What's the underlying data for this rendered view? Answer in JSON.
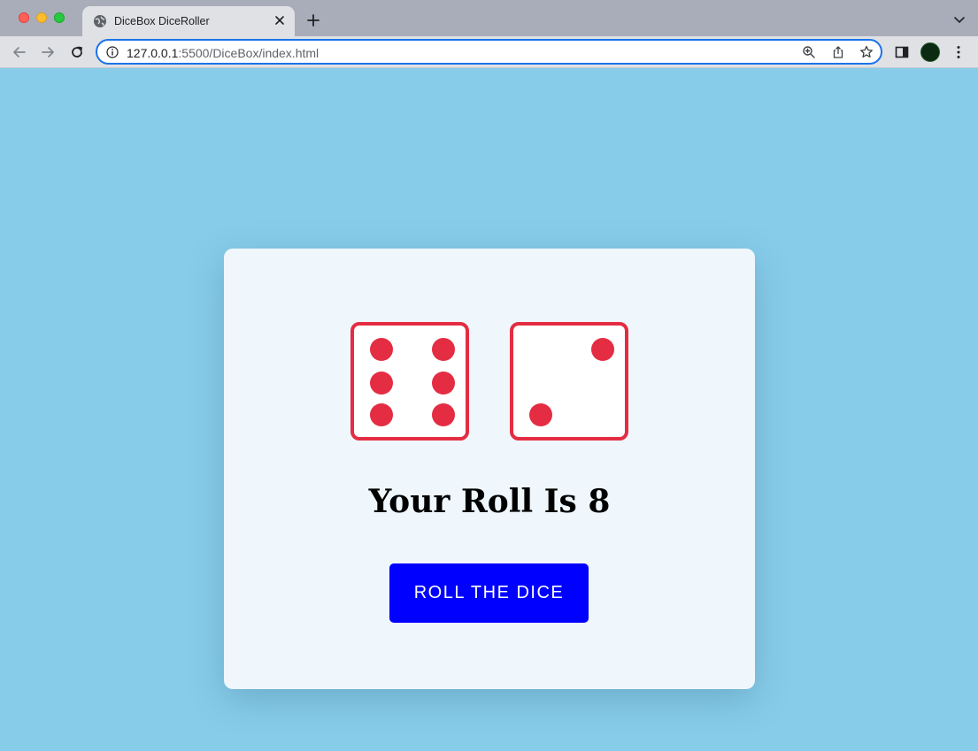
{
  "browser": {
    "tab_title": "DiceBox DiceRoller",
    "url_host": "127.0.0.1",
    "url_rest": ":5500/DiceBox/index.html"
  },
  "game": {
    "die_left_value": 6,
    "die_right_value": 2,
    "heading": "Your Roll Is 8",
    "button_label": "ROLL THE DICE"
  },
  "colors": {
    "page_background": "#87cdea",
    "card_background": "#eff7fd",
    "die_accent": "#e42c42",
    "button": "#0000ff"
  }
}
